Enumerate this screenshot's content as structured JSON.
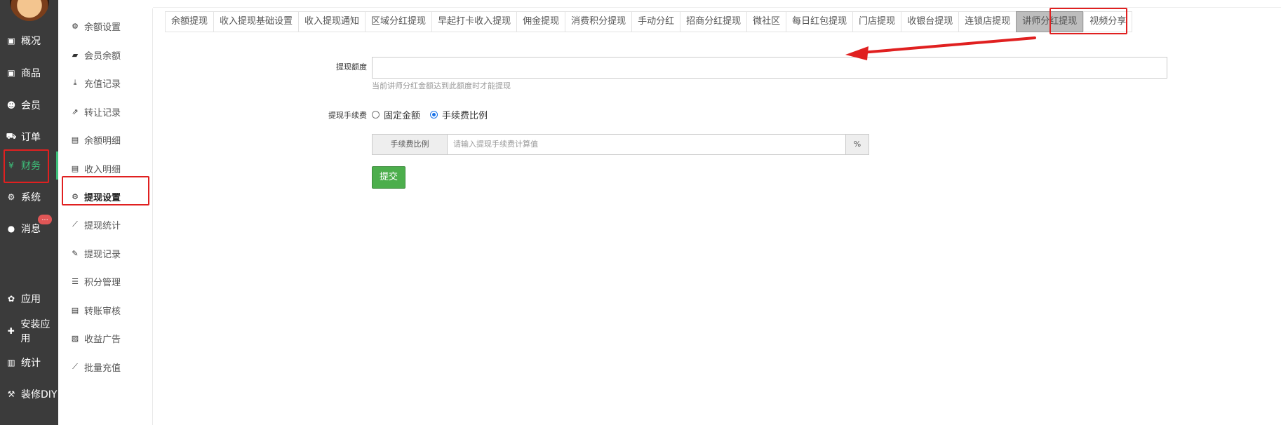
{
  "leftnav": {
    "items": [
      {
        "label": "概况",
        "icon": "dashboard-icon"
      },
      {
        "label": "商品",
        "icon": "product-icon"
      },
      {
        "label": "会员",
        "icon": "users-icon"
      },
      {
        "label": "订单",
        "icon": "cart-icon"
      },
      {
        "label": "财务",
        "icon": "yen-icon",
        "active": true
      },
      {
        "label": "系统",
        "icon": "gears-icon"
      },
      {
        "label": "消息",
        "icon": "chat-icon"
      },
      {
        "label": "应用",
        "icon": "apps-icon"
      },
      {
        "label": "安装应用",
        "icon": "puzzle-icon"
      },
      {
        "label": "统计",
        "icon": "bar-chart-icon"
      },
      {
        "label": "装修DIY",
        "icon": "hammer-icon"
      }
    ],
    "message_badge": "..."
  },
  "subnav": {
    "items": [
      {
        "label": "余额设置",
        "icon": "gear-icon"
      },
      {
        "label": "会员余额",
        "icon": "book-icon"
      },
      {
        "label": "充值记录",
        "icon": "download-icon"
      },
      {
        "label": "转让记录",
        "icon": "external-link-icon"
      },
      {
        "label": "余额明细",
        "icon": "file-icon"
      },
      {
        "label": "收入明细",
        "icon": "file-icon"
      },
      {
        "label": "提现设置",
        "icon": "gear-icon",
        "active": true
      },
      {
        "label": "提现统计",
        "icon": "line-chart-icon"
      },
      {
        "label": "提现记录",
        "icon": "pencil-icon"
      },
      {
        "label": "积分管理",
        "icon": "database-icon"
      },
      {
        "label": "转账审核",
        "icon": "file-icon"
      },
      {
        "label": "收益广告",
        "icon": "image-icon"
      },
      {
        "label": "批量充值",
        "icon": "line-chart-icon"
      }
    ]
  },
  "tabs": [
    "余额提现",
    "收入提现基础设置",
    "收入提现通知",
    "区域分红提现",
    "早起打卡收入提现",
    "佣金提现",
    "消费积分提现",
    "手动分红",
    "招商分红提现",
    "微社区",
    "每日红包提现",
    "门店提现",
    "收银台提现",
    "连锁店提现",
    "讲师分红提现",
    "视频分享"
  ],
  "active_tab": "讲师分红提现",
  "form": {
    "amount_label": "提现额度",
    "amount_value": "",
    "amount_hint": "当前讲师分红金额达到此额度时才能提现",
    "fee_label": "提现手续费",
    "fee_options": [
      "固定金额",
      "手续费比例"
    ],
    "fee_selected": "手续费比例",
    "ratio_addon": "手续费比例",
    "ratio_placeholder": "请输入提现手续费计算值",
    "ratio_suffix": "%",
    "submit_label": "提交"
  },
  "colors": {
    "accent_green": "#3dc07a",
    "submit_green": "#4cae4c",
    "annotation_red": "#e02020",
    "nav_bg": "#3b3b3b"
  }
}
